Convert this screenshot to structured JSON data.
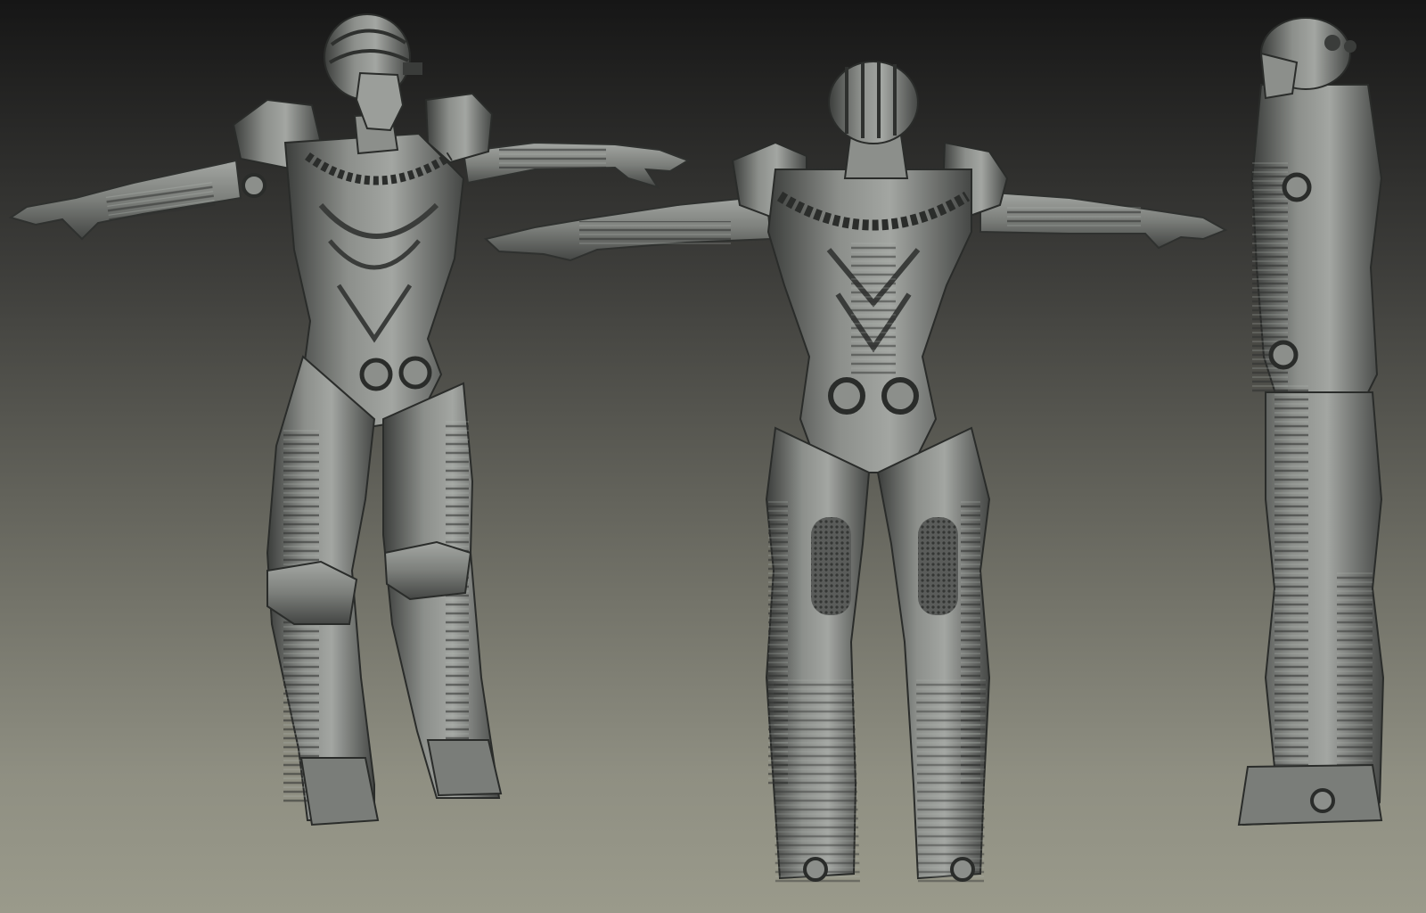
{
  "scene": {
    "views": [
      {
        "id": "front-three-quarter",
        "subject": "armored-figure"
      },
      {
        "id": "back",
        "subject": "armored-figure"
      },
      {
        "id": "side",
        "subject": "armored-figure"
      }
    ]
  },
  "colors": {
    "background_top": "#161616",
    "background_bottom": "#9a9a8b",
    "armor_base": "#6d706d",
    "armor_light": "#a3a6a2",
    "armor_dark": "#2f312f"
  }
}
